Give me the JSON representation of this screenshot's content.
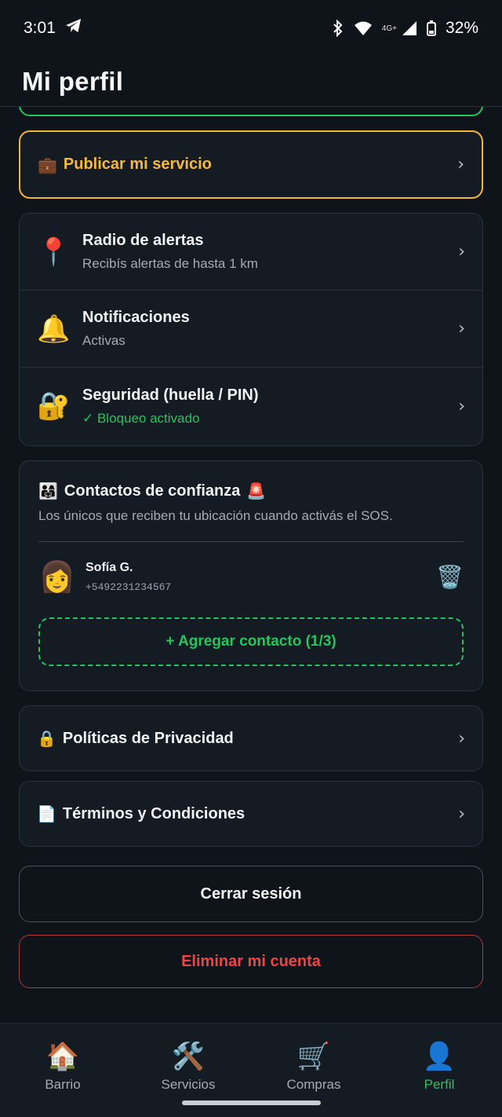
{
  "status_bar": {
    "time": "3:01",
    "network_label": "4G+",
    "battery": "32%",
    "icons": [
      "telegram-icon",
      "bluetooth-icon",
      "wifi-icon",
      "signal-icon",
      "battery-icon"
    ]
  },
  "header": {
    "title": "Mi perfil"
  },
  "publish": {
    "icon": "💼",
    "label": "Publicar mi servicio",
    "chevron": "›"
  },
  "settings": {
    "items": [
      {
        "icon": "📍",
        "title": "Radio de alertas",
        "subtitle": "Recibís alertas de hasta 1 km",
        "chevron": "›"
      },
      {
        "icon": "🔔",
        "title": "Notificaciones",
        "subtitle": "Activas",
        "chevron": "›"
      },
      {
        "icon": "🔐",
        "title": "Seguridad (huella / PIN)",
        "subtitle": "✓ Bloqueo activado",
        "chevron": "›"
      }
    ]
  },
  "contacts": {
    "title_icon": "👨‍👩‍👧",
    "title": "Contactos de confianza",
    "title_badge": "🚨",
    "description": "Los únicos que reciben tu ubicación cuando activás el SOS.",
    "items": [
      {
        "avatar": "👩",
        "name": "Sofía G.",
        "phone": "+5492231234567",
        "delete_icon": "🗑️"
      }
    ],
    "add_label": "+ Agregar contacto (1/3)"
  },
  "links": {
    "privacy": {
      "icon": "🔒",
      "label": "Políticas de Privacidad",
      "chevron": "›"
    },
    "terms": {
      "icon": "📄",
      "label": "Términos y Condiciones",
      "chevron": "›"
    }
  },
  "actions": {
    "logout": "Cerrar sesión",
    "delete": "Eliminar mi cuenta"
  },
  "bottom_nav": {
    "items": [
      {
        "icon": "🏠",
        "label": "Barrio"
      },
      {
        "icon": "🛠️",
        "label": "Servicios"
      },
      {
        "icon": "🛒",
        "label": "Compras"
      },
      {
        "icon": "👤",
        "label": "Perfil"
      }
    ],
    "active": "Perfil"
  },
  "colors": {
    "background": "#0f141b",
    "card": "#151b23",
    "accent_green": "#22c55e",
    "accent_yellow": "#f6b93b",
    "danger": "#ef4444"
  }
}
